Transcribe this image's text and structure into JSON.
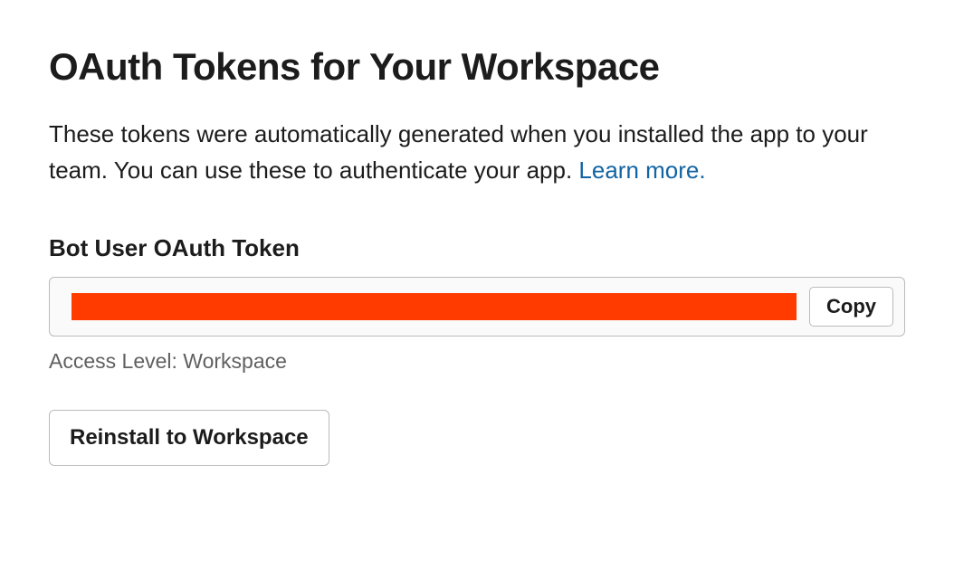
{
  "header": {
    "title": "OAuth Tokens for Your Workspace"
  },
  "description": {
    "text": "These tokens were automatically generated when you installed the app to your team. You can use these to authenticate your app. ",
    "learn_more_label": "Learn more."
  },
  "token_section": {
    "label": "Bot User OAuth Token",
    "copy_label": "Copy",
    "access_level_label": "Access Level: Workspace"
  },
  "actions": {
    "reinstall_label": "Reinstall to Workspace"
  }
}
